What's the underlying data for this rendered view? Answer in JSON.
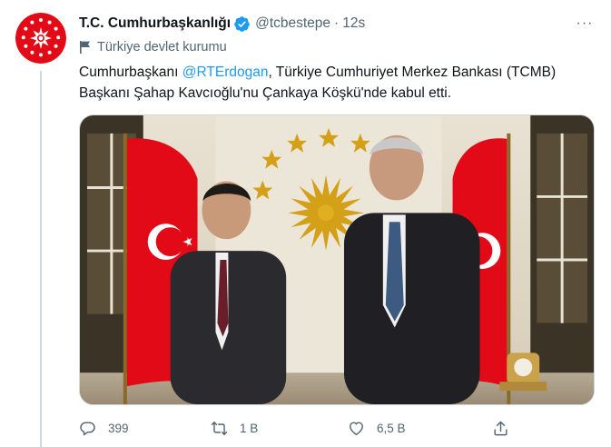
{
  "tweet": {
    "author_name": "T.C. Cumhurbaşkanlığı",
    "handle": "@tcbestepe",
    "separator": "·",
    "time": "12s",
    "account_label": "Türkiye devlet kurumu",
    "text_part1": "Cumhurbaşkanı ",
    "mention": "@RTErdogan",
    "text_part2": ", Türkiye Cumhuriyet Merkez Bankası (TCMB) Başkanı Şahap Kavcıoğlu'nu Çankaya Köşkü'nde kabul etti.",
    "more_label": "···"
  },
  "actions": {
    "reply_count": "399",
    "retweet_count": "1 B",
    "like_count": "6,5 B"
  },
  "colors": {
    "accent": "#1d9bf0",
    "secondary_text": "#536471",
    "flag_red": "#e30a17"
  },
  "icons": {
    "verified": "verified-badge-icon",
    "label": "flag-icon",
    "reply": "reply-icon",
    "retweet": "retweet-icon",
    "like": "heart-icon",
    "share": "share-icon",
    "more": "more-icon"
  }
}
